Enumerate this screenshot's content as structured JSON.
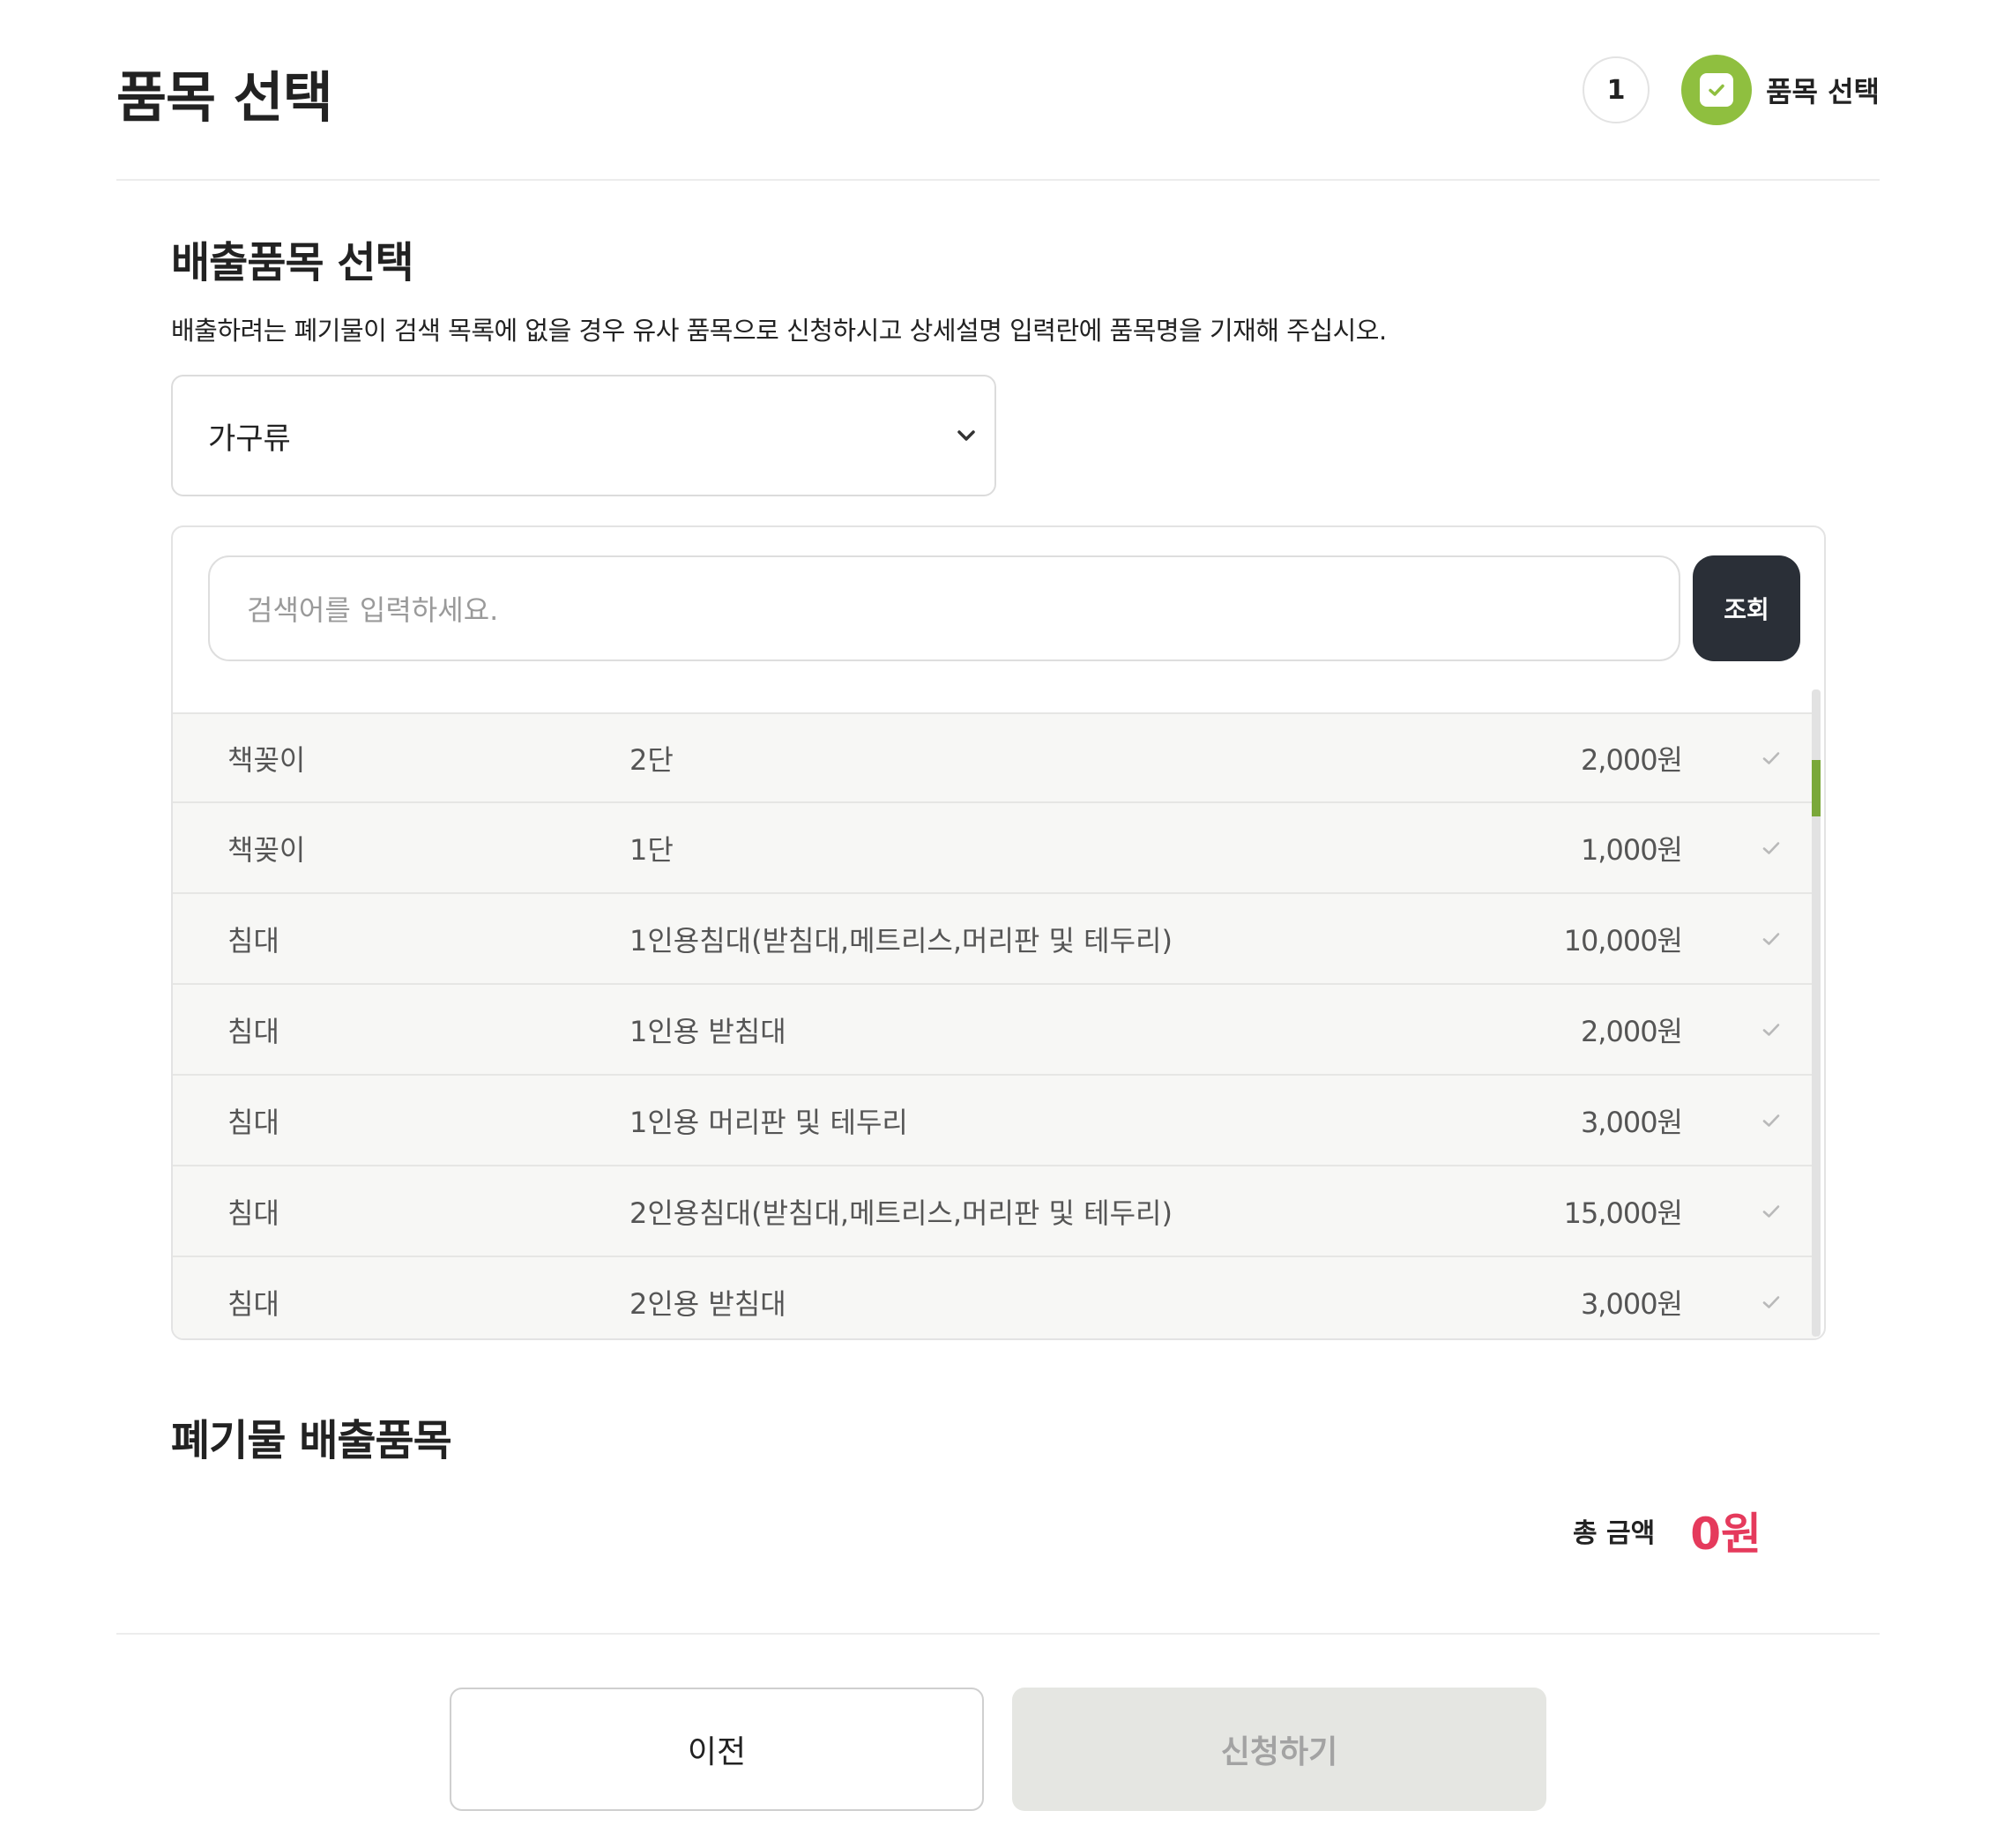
{
  "header": {
    "title": "품목 선택",
    "step_number": "1",
    "step_label": "품목 선택"
  },
  "section1": {
    "title": "배출품목 선택",
    "description": "배출하려는 폐기물이 검색 목록에 없을 경우 유사 품목으로 신청하시고 상세설명 입력란에 품목명을 기재해 주십시오.",
    "category_select": "가구류",
    "search_placeholder": "검색어를 입력하세요.",
    "search_button": "조회"
  },
  "items": [
    {
      "category": "책꽂이",
      "name": "2단",
      "price": "2,000원"
    },
    {
      "category": "책꽂이",
      "name": "1단",
      "price": "1,000원"
    },
    {
      "category": "침대",
      "name": "1인용침대(받침대,메트리스,머리판 및 테두리)",
      "price": "10,000원"
    },
    {
      "category": "침대",
      "name": "1인용 받침대",
      "price": "2,000원"
    },
    {
      "category": "침대",
      "name": "1인용 머리판 및 테두리",
      "price": "3,000원"
    },
    {
      "category": "침대",
      "name": "2인용침대(받침대,메트리스,머리판 및 테두리)",
      "price": "15,000원"
    },
    {
      "category": "침대",
      "name": "2인용 받침대",
      "price": "3,000원"
    }
  ],
  "section2": {
    "title": "폐기물 배출품목",
    "total_label": "총 금액",
    "total_value": "0원"
  },
  "buttons": {
    "prev": "이전",
    "apply": "신청하기"
  },
  "colors": {
    "accent_green": "#8fbf3f",
    "total_red": "#e53a5c",
    "dark_button": "#2a2f37"
  }
}
